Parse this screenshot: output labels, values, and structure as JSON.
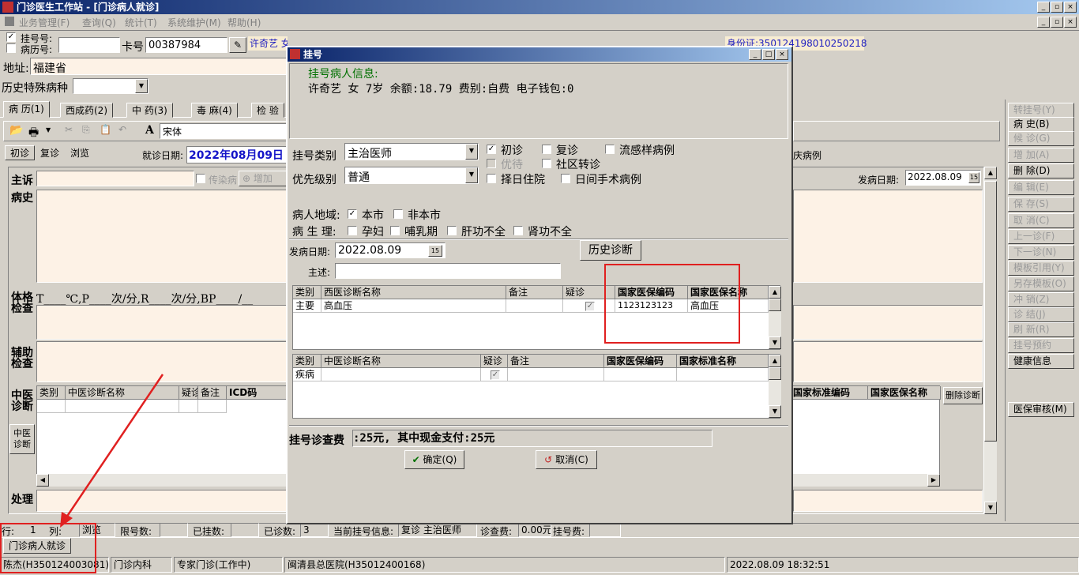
{
  "app": {
    "title": "门诊医生工作站 - [门诊病人就诊]"
  },
  "menu": [
    "业务管理(F)",
    "查询(Q)",
    "统计(T)",
    "系统维护(M)",
    "帮助(H)"
  ],
  "patient_bar": {
    "reg_no_label": "挂号号:",
    "record_no_label": "病历号:",
    "card_label": "卡号",
    "card_value": "00387984",
    "summary": "许奇艺 女 7岁 余额:18.79 费别:自费 电子钱包:0",
    "id_card": "身份证:350124198010250218"
  },
  "address": {
    "label": "地址:",
    "value": "福建省"
  },
  "special_disease": {
    "label": "历史特殊病种"
  },
  "main_tabs": [
    "病 历(1)",
    "西成药(2)",
    "中 药(3)",
    "毒 麻(4)",
    "检 验"
  ],
  "toolbar": {
    "font_value": "宋体"
  },
  "visit_tabs": [
    "初诊",
    "复诊",
    "浏览"
  ],
  "visit_date": {
    "label": "就诊日期:",
    "value": "2022年08月09日"
  },
  "record": {
    "complaint_label": "主诉",
    "infectious_label": "传染病",
    "add_label": "增加",
    "history_label": "病史",
    "onset_label": "发病日期:",
    "onset_value": "2022.08.09",
    "exam_label_1": "体格",
    "exam_label_2": "检查",
    "vitals": "T____℃,P____次/分,R____次/分,BP____/__",
    "aux_label_1": "辅助",
    "aux_label_2": "检查",
    "tcm_label_1": "中医",
    "tcm_label_2": "诊断",
    "tcm_button": "中医诊断",
    "treat_label": "处理",
    "right_case_label": "庆病例"
  },
  "tcm_grid": {
    "headers": [
      "类别",
      "中医诊断名称",
      "疑诊",
      "备注",
      "ICD码"
    ]
  },
  "right_grid": {
    "headers": [
      "国家标准编码",
      "国家医保名称"
    ],
    "delete_label": "删除诊断"
  },
  "side_buttons": [
    {
      "label": "转挂号(Y)",
      "disabled": true
    },
    {
      "label": "病  史(B)",
      "disabled": false
    },
    {
      "label": "候  诊(G)",
      "disabled": true
    },
    {
      "label": "增  加(A)",
      "disabled": true
    },
    {
      "label": "删  除(D)",
      "disabled": false
    },
    {
      "label": "编  辑(E)",
      "disabled": true
    },
    {
      "label": "保  存(S)",
      "disabled": true
    },
    {
      "label": "取  消(C)",
      "disabled": true
    },
    {
      "label": "上一诊(F)",
      "disabled": true
    },
    {
      "label": "下一诊(N)",
      "disabled": true
    },
    {
      "label": "模板引用(Y)",
      "disabled": true
    },
    {
      "label": "另存模板(O)",
      "disabled": true
    },
    {
      "label": "冲  销(Z)",
      "disabled": true
    },
    {
      "label": "诊  结(J)",
      "disabled": true
    },
    {
      "label": "刷  新(R)",
      "disabled": true
    },
    {
      "label": "挂号预约",
      "disabled": true
    },
    {
      "label": "健康信息",
      "disabled": false
    },
    {
      "label": "医保审核(M)",
      "disabled": false
    }
  ],
  "status_row": {
    "row_label": "行:",
    "row_value": "1",
    "col_label": "列:",
    "browse": "浏览",
    "limit": "限号数:",
    "registered": "已挂数:",
    "diagnosed": "已诊数:",
    "diagnosed_value": "3",
    "current": "当前挂号信息:",
    "current_value": "复诊 主治医师",
    "fee": "诊查费:",
    "fee_value": "0.00元",
    "reg_fee": "挂号费:"
  },
  "window_tab": "门诊病人就诊",
  "statusbar": {
    "doctor": "陈杰(H350124003081)",
    "dept": "门诊内科",
    "clinic": "专家门诊(工作中)",
    "hospital": "闽清县总医院(H35012400168)",
    "datetime": "2022.08.09 18:32:51"
  },
  "dialog": {
    "title": "挂号",
    "info_label": "挂号病人信息:",
    "info_value": "许奇艺 女 7岁 余额:18.79 费别:自费 电子钱包:0",
    "reg_type_label": "挂号类别",
    "reg_type_value": "主治医师",
    "priority_label": "优先级别",
    "priority_value": "普通",
    "cb_first": "初诊",
    "cb_return": "复诊",
    "cb_flu": "流感样病例",
    "cb_preferred": "优待",
    "cb_community": "社区转诊",
    "cb_hospital": "择日住院",
    "cb_daysurgery": "日间手术病例",
    "region_label": "病人地域:",
    "region_local": "本市",
    "region_nonlocal": "非本市",
    "physio_label": "病 生 理:",
    "physio_pregnant": "孕妇",
    "physio_lactation": "哺乳期",
    "physio_liver": "肝功不全",
    "physio_kidney": "肾功不全",
    "onset_label": "发病日期:",
    "onset_value": "2022.08.09",
    "history_button": "历史诊断",
    "complaint_label": "主述:",
    "wm_headers": [
      "类别",
      "西医诊断名称",
      "备注",
      "疑诊",
      "国家医保编码",
      "国家医保名称"
    ],
    "wm_rows": [
      {
        "cat": "主要",
        "name": "高血压",
        "note": "",
        "suspect": "✓",
        "code": "1123123123",
        "insname": "高血压"
      }
    ],
    "tcm_headers": [
      "类别",
      "中医诊断名称",
      "疑诊",
      "备注",
      "国家医保编码",
      "国家标准名称"
    ],
    "tcm_rows": [
      {
        "cat": "疾病",
        "name": "",
        "suspect": "✓",
        "note": "",
        "code": "",
        "stdname": ""
      }
    ],
    "fee_label": "挂号诊查费",
    "fee_value": ":25元, 其中现金支付:25元",
    "ok_button": "确定(Q)",
    "cancel_button": "取消(C)"
  },
  "colors": {
    "title": "#0a246a",
    "cream": "#fdf2e6",
    "highlight": "#e02020",
    "blue_text": "#1414c8",
    "green_text": "#007000"
  }
}
